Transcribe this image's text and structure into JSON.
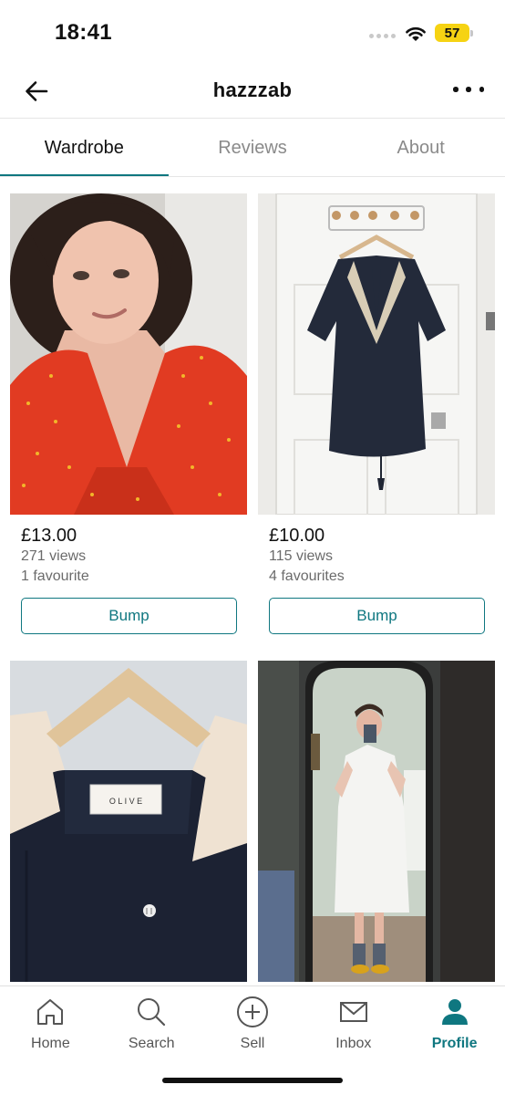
{
  "status_bar": {
    "time": "18:41",
    "battery": "57"
  },
  "header": {
    "title": "hazzzab",
    "back_icon": "arrow-left-icon",
    "more_icon": "more-horizontal-icon"
  },
  "tabs": [
    {
      "label": "Wardrobe",
      "active": true
    },
    {
      "label": "Reviews",
      "active": false
    },
    {
      "label": "About",
      "active": false
    }
  ],
  "items": [
    {
      "price": "£13.00",
      "views": "271 views",
      "favourites": "1 favourite",
      "bump_label": "Bump",
      "photo": "red polka dot wrap top"
    },
    {
      "price": "£10.00",
      "views": "115 views",
      "favourites": "4 favourites",
      "bump_label": "Bump",
      "photo": "navy embroidered dress on hanger"
    },
    {
      "photo": "navy shirt with cream collar on hanger",
      "tag_text": "O L I V E"
    },
    {
      "photo": "white dress mirror selfie"
    }
  ],
  "bottom_nav": [
    {
      "label": "Home",
      "icon": "home-icon",
      "active": false
    },
    {
      "label": "Search",
      "icon": "search-icon",
      "active": false
    },
    {
      "label": "Sell",
      "icon": "plus-circle-icon",
      "active": false
    },
    {
      "label": "Inbox",
      "icon": "mail-icon",
      "active": false
    },
    {
      "label": "Profile",
      "icon": "person-icon",
      "active": true
    }
  ],
  "colors": {
    "accent": "#0f7780",
    "battery": "#f6d313"
  }
}
